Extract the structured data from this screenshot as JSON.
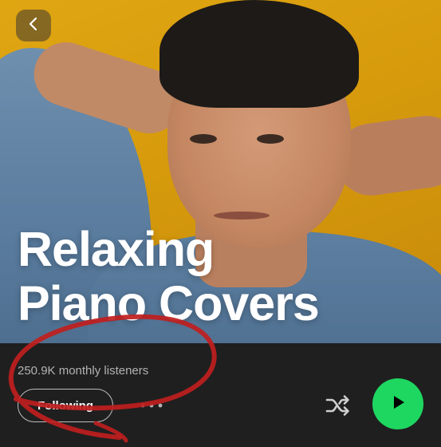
{
  "artist": {
    "name": "Relaxing\nPiano Covers",
    "monthly_listeners": "250.9K monthly listeners"
  },
  "actions": {
    "following_label": "Following"
  },
  "icons": {
    "back": "chevron-left-icon",
    "more": "more-horizontal-icon",
    "shuffle": "shuffle-icon",
    "play": "play-icon"
  },
  "colors": {
    "accent_green": "#1ed760",
    "annotation_red": "#c01e1e",
    "panel_background": "#1f1f1f"
  }
}
